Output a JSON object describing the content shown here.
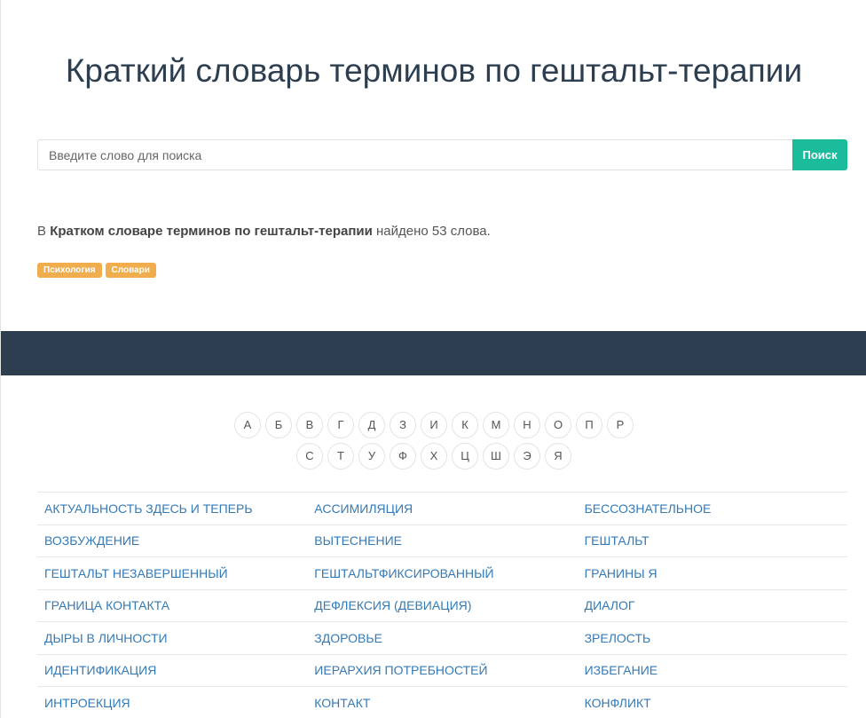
{
  "title": "Краткий словарь терминов по гештальт-терапии",
  "search": {
    "placeholder": "Введите слово для поиска",
    "button_label": "Поиск"
  },
  "summary": {
    "prefix": "В ",
    "dictionary_name": "Кратком словаре терминов по гештальт-терапии",
    "suffix": " найдено 53 слова."
  },
  "tags": [
    "Психология",
    "Словари"
  ],
  "alphabet": {
    "row1": [
      "А",
      "Б",
      "В",
      "Г",
      "Д",
      "З",
      "И",
      "К",
      "М",
      "Н",
      "О",
      "П",
      "Р"
    ],
    "row2": [
      "С",
      "Т",
      "У",
      "Ф",
      "Х",
      "Ц",
      "Ш",
      "Э",
      "Я"
    ]
  },
  "terms": [
    [
      "АКТУАЛЬНОСТЬ ЗДЕСЬ И ТЕПЕРЬ",
      "АССИМИЛЯЦИЯ",
      "БЕССОЗНАТЕЛЬНОЕ"
    ],
    [
      "ВОЗБУЖДЕНИЕ",
      "ВЫТЕСНЕНИЕ",
      "ГЕШТАЛЬТ"
    ],
    [
      "ГЕШТАЛЬТ НЕЗАВЕРШЕННЫЙ",
      "ГЕШТАЛЬТФИКСИРОВАННЫЙ",
      "ГРАНИНЫ Я"
    ],
    [
      "ГРАНИЦА КОНТАКТА",
      "ДЕФЛЕКСИЯ (ДЕВИАЦИЯ)",
      "ДИАЛОГ"
    ],
    [
      "ДЫРЫ В ЛИЧНОСТИ",
      "ЗДОРОВЬЕ",
      "ЗРЕЛОСТЬ"
    ],
    [
      "ИДЕНТИФИКАЦИЯ",
      "ИЕРАРХИЯ ПОТРЕБНОСТЕЙ",
      "ИЗБЕГАНИЕ"
    ],
    [
      "ИНТРОЕКЦИЯ",
      "КОНТАКТ",
      "КОНФЛИКТ"
    ]
  ]
}
